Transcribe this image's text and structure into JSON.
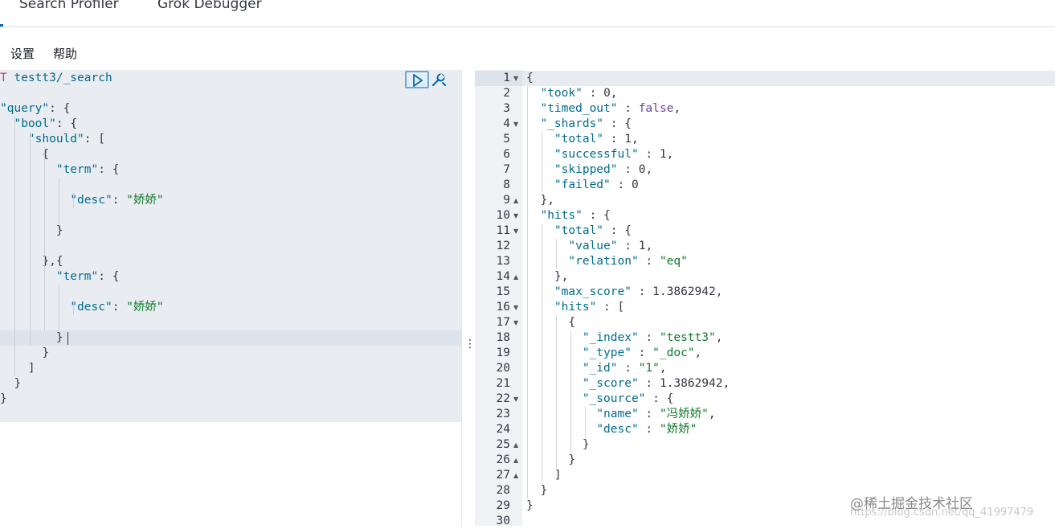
{
  "tabs": {
    "profiler": "Search Profiler",
    "grok": "Grok Debugger"
  },
  "menu": {
    "settings": "设置",
    "help": "帮助"
  },
  "request": {
    "method": "T",
    "url": "testt3/_search",
    "lines": [
      "",
      "\"query\": {",
      "  \"bool\": {",
      "    \"should\": [",
      "      {",
      "        \"term\": {",
      "",
      "          \"desc\": \"娇娇\"",
      "",
      "        }",
      "",
      "      },{",
      "        \"term\": {",
      "",
      "          \"desc\": \"娇娇\"",
      "",
      "        }",
      "      }",
      "    ]",
      "  }",
      "}"
    ]
  },
  "response": {
    "lines": [
      "{",
      "  \"took\" : 0,",
      "  \"timed_out\" : false,",
      "  \"_shards\" : {",
      "    \"total\" : 1,",
      "    \"successful\" : 1,",
      "    \"skipped\" : 0,",
      "    \"failed\" : 0",
      "  },",
      "  \"hits\" : {",
      "    \"total\" : {",
      "      \"value\" : 1,",
      "      \"relation\" : \"eq\"",
      "    },",
      "    \"max_score\" : 1.3862942,",
      "    \"hits\" : [",
      "      {",
      "        \"_index\" : \"testt3\",",
      "        \"_type\" : \"_doc\",",
      "        \"_id\" : \"1\",",
      "        \"_score\" : 1.3862942,",
      "        \"_source\" : {",
      "          \"name\" : \"冯娇娇\",",
      "          \"desc\" : \"娇娇\"",
      "        }",
      "      }",
      "    ]",
      "  }",
      "}",
      ""
    ],
    "line_numbers": [
      "1",
      "2",
      "3",
      "4",
      "5",
      "6",
      "7",
      "8",
      "9",
      "10",
      "11",
      "12",
      "13",
      "14",
      "15",
      "16",
      "17",
      "18",
      "19",
      "20",
      "21",
      "22",
      "23",
      "24",
      "25",
      "26",
      "27",
      "28",
      "29",
      "30"
    ],
    "fold_down": [
      1,
      4,
      10,
      11,
      16,
      17,
      22
    ],
    "fold_up": [
      9,
      14,
      25,
      26,
      27
    ]
  },
  "icons": {
    "run": "play-icon",
    "settings": "wrench-icon",
    "splitter": "vertical-dots-icon"
  },
  "watermark": {
    "main": "@稀土掘金技术社区",
    "url": "https://blog.csdn.net/qq_41997479"
  },
  "colors": {
    "key": "#006b8f",
    "string": "#0b7a28",
    "boolean": "#6b3fa0",
    "method": "#c4407c",
    "accent": "#006bb4"
  }
}
